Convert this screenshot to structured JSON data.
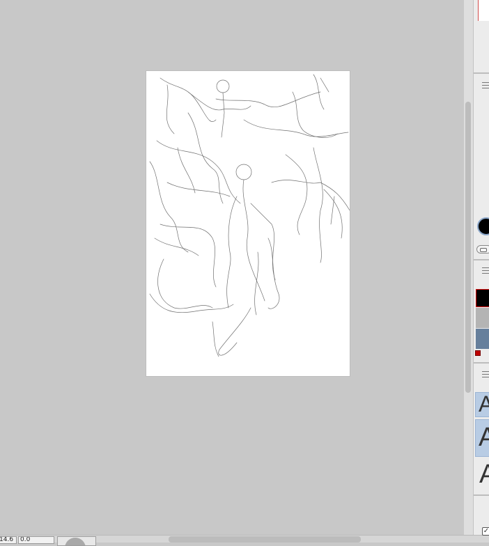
{
  "status_bar": {
    "zoom": "14.6",
    "rotation": "0.0"
  },
  "colors": {
    "workspace_bg": "#c8c8c8",
    "canvas_bg": "#ffffff",
    "main_color": "#000000",
    "palette": [
      "#000000",
      "#b4b4b4",
      "#667f9c",
      "#c00000"
    ]
  },
  "icons": [
    "panel-menu-icon",
    "color-link-icon",
    "checkbox-icon"
  ],
  "font_samples": [
    "A",
    "A",
    "A"
  ]
}
